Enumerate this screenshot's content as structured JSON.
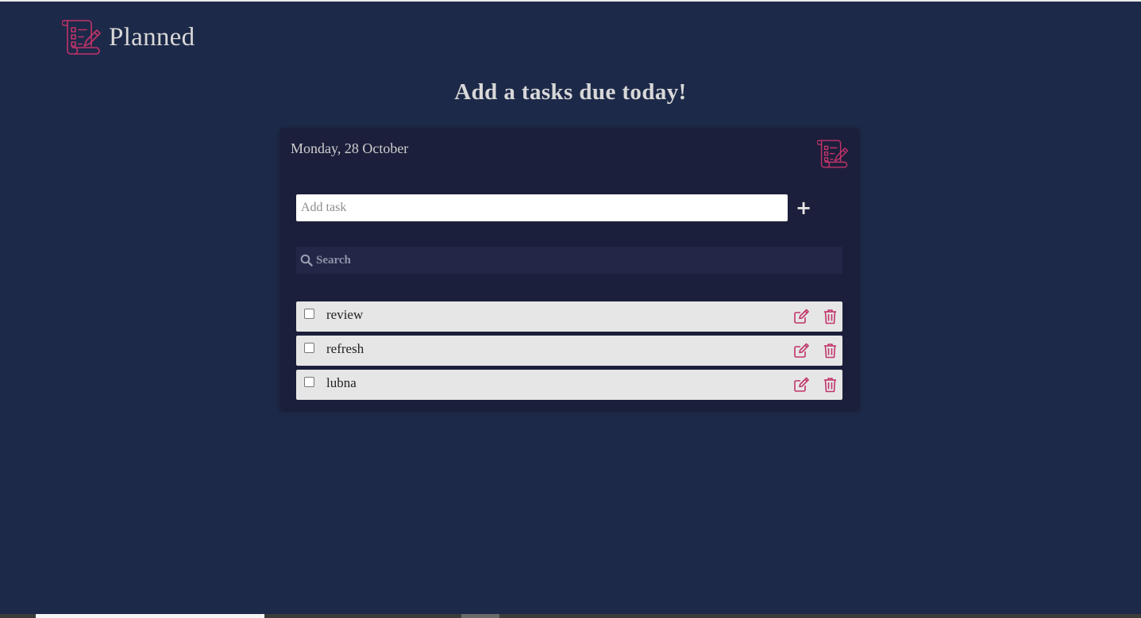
{
  "brand": {
    "title": "Planned",
    "logo_icon": "scroll-checklist-icon"
  },
  "heading": "Add a tasks due today!",
  "card": {
    "date": "Monday, 28 October",
    "logo_icon": "scroll-checklist-icon"
  },
  "add_task": {
    "placeholder": "Add task",
    "value": "",
    "button_label": "+"
  },
  "search": {
    "placeholder": "Search",
    "value": "",
    "icon": "search-icon"
  },
  "tasks": [
    {
      "label": "review",
      "checked": false
    },
    {
      "label": "refresh",
      "checked": false
    },
    {
      "label": "lubna",
      "checked": false
    }
  ],
  "colors": {
    "background": "#1d2948",
    "card": "#1c1f3b",
    "accent": "#c0336a",
    "task_row": "#e6e6e6",
    "search_bg": "#222647"
  }
}
